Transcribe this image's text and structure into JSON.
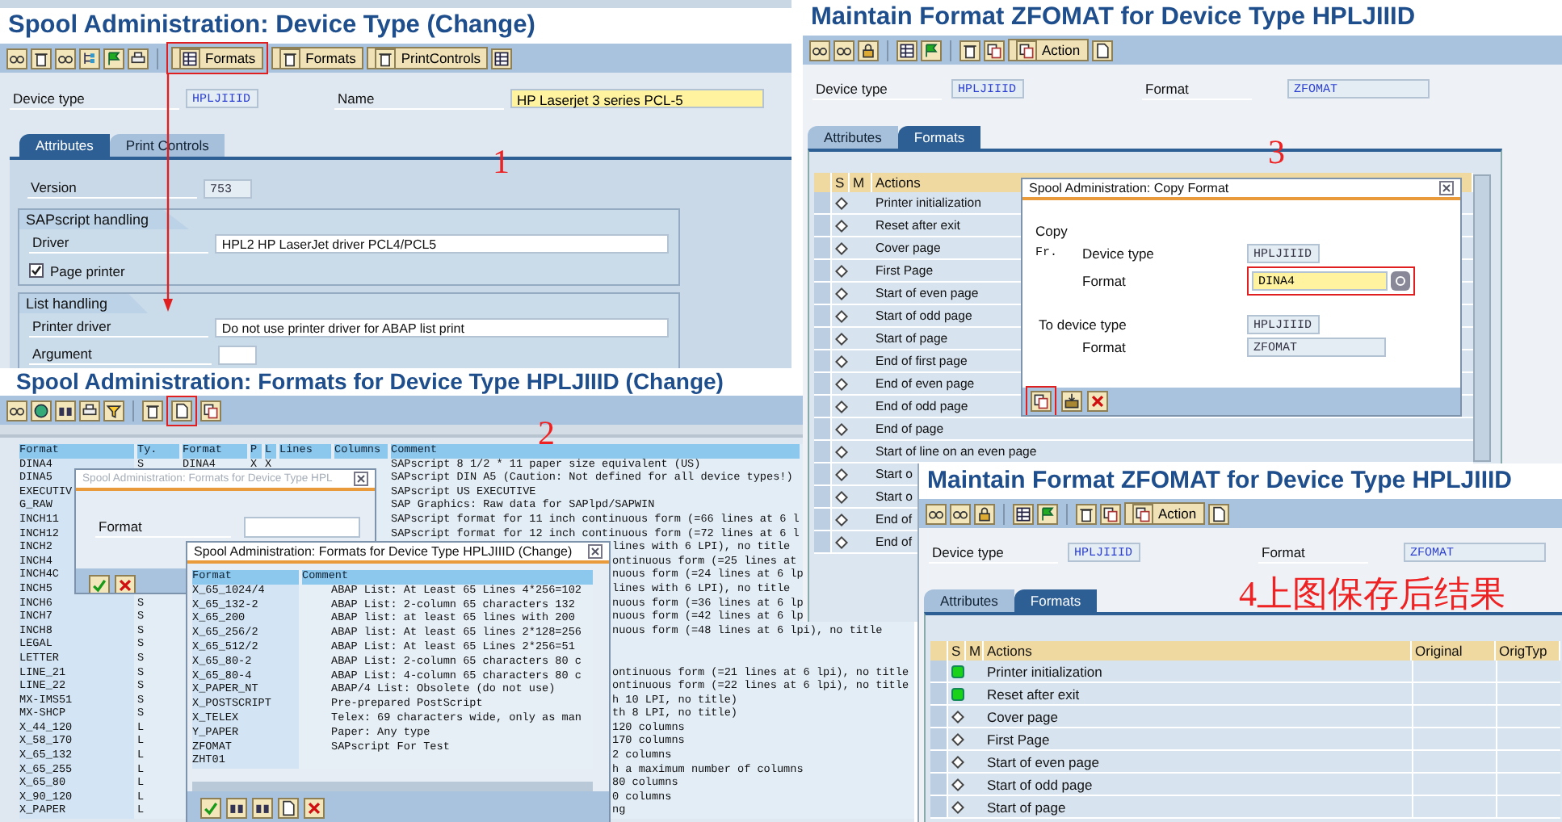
{
  "device_type_screen": {
    "title": "Spool Administration: Device Type (Change)",
    "toolbar": [
      {
        "label": "Formats",
        "highlighted": true
      },
      {
        "label": "Formats",
        "highlighted": false
      },
      {
        "label": "PrintControls",
        "highlighted": false
      }
    ],
    "fields": [
      {
        "label": "Device type",
        "value": "HPLJIIID",
        "kind": "display"
      },
      {
        "label": "Name",
        "value": "HP Laserjet 3 series PCL-5",
        "kind": "input"
      }
    ],
    "tabs": [
      {
        "label": "Attributes",
        "selected": true
      },
      {
        "label": "Print Controls",
        "selected": false
      }
    ],
    "annotation": "1",
    "version": {
      "label": "Version",
      "value": "753"
    },
    "groups": [
      {
        "title": "SAPscript handling",
        "rows": [
          {
            "kind": "field",
            "label": "Driver",
            "value": "HPL2 HP LaserJet driver PCL4/PCL5"
          },
          {
            "kind": "checkbox",
            "label": "Page printer",
            "checked": true
          }
        ]
      },
      {
        "title": "List handling",
        "rows": [
          {
            "kind": "field",
            "label": "Printer driver",
            "value": "Do not use printer driver for ABAP list print"
          },
          {
            "kind": "short",
            "label": "Argument"
          }
        ]
      }
    ]
  },
  "formats_screen": {
    "title": "Spool Administration: Formats for Device Type HPLJIIID (Change)",
    "toolbar": [
      {
        "highlighted": false
      },
      {
        "highlighted": false
      },
      {
        "highlighted": false
      },
      {
        "highlighted": false
      },
      {
        "highlighted": false
      },
      {
        "highlighted": false
      },
      {
        "highlighted": true
      },
      {
        "highlighted": false
      }
    ],
    "annotation": "2",
    "columns": [
      "Format",
      "Ty.",
      "Format",
      "P",
      "L",
      "Lines",
      "Columns",
      "Comment"
    ],
    "rows": [
      {
        "format": "DINA4",
        "type": "S",
        "format_2": "DINA4",
        "p": "X",
        "l": "X",
        "comment": "SAPscript 8 1/2 * 11 paper size equivalent (US)"
      },
      {
        "format": "DINA5",
        "comment": "SAPscript DIN A5 (Caution: Not defined for all device types!)"
      },
      {
        "format": "EXECUTIV",
        "comment": "SAPscript US EXECUTIVE"
      },
      {
        "format": "G_RAW",
        "comment": "SAP Graphics: Raw data for SAPlpd/SAPWIN"
      },
      {
        "format": "INCH11",
        "comment": "SAPscript format for 11 inch continuous form (=66 lines at 6 l"
      },
      {
        "format": "INCH12",
        "comment": "SAPscript format for 12 inch continuous form (=72 lines at 6 l"
      },
      {
        "format": "INCH2",
        "comment_tail": "lines with 6 LPI), no title"
      },
      {
        "format": "INCH4",
        "comment_tail": "ontinuous form (=25 lines at"
      },
      {
        "format": "INCH4C",
        "comment_tail": "nuous form (=24 lines at 6 lp"
      },
      {
        "format": "INCH5",
        "comment_tail": "lines with 6 LPI), no title"
      },
      {
        "format": "INCH6",
        "type": "S",
        "comment_tail": "nuous form (=36 lines at 6 lp"
      },
      {
        "format": "INCH7",
        "type": "S",
        "comment_tail": "nuous form (=42 lines at 6 lp"
      },
      {
        "format": "INCH8",
        "type": "S",
        "comment_tail": "nuous form (=48 lines at 6 lpi), no title"
      },
      {
        "format": "LEGAL",
        "type": "S"
      },
      {
        "format": "LETTER",
        "type": "S"
      },
      {
        "format": "LINE_21",
        "type": "S",
        "comment_tail": "ontinuous form (=21 lines at 6 lpi), no title"
      },
      {
        "format": "LINE_22",
        "type": "S",
        "comment_tail": "ontinuous form (=22 lines at 6 lpi), no title"
      },
      {
        "format": "MX-IMS51",
        "type": "S",
        "comment_tail": "h 10 LPI, no title)"
      },
      {
        "format": "MX-SHCP",
        "type": "S",
        "comment_tail": "th 8 LPI, no title)"
      },
      {
        "format": "X_44_120",
        "type": "L",
        "comment_tail": "120 columns"
      },
      {
        "format": "X_58_170",
        "type": "L",
        "comment_tail": "170 columns"
      },
      {
        "format": "X_65_132",
        "type": "L",
        "comment_tail": "2 columns"
      },
      {
        "format": "X_65_255",
        "type": "L",
        "comment_tail": "h a maximum number of columns"
      },
      {
        "format": "X_65_80",
        "type": "L",
        "comment_tail": "80 columns"
      },
      {
        "format": "X_90_120",
        "type": "L",
        "comment_tail": "0 columns"
      },
      {
        "format": "X_PAPER",
        "type": "L",
        "comment_tail": "ng"
      }
    ],
    "format_dialog": {
      "title": "Spool Administration: Formats for Device Type HPL",
      "field_label": "Format"
    },
    "list_dialog": {
      "title": "Spool Administration: Formats for Device Type HPLJIIID (Change)",
      "columns": [
        "Format",
        "Comment"
      ],
      "rows": [
        {
          "format": "X_65_1024/4",
          "comment": "ABAP List: At Least 65 Lines 4*256=102"
        },
        {
          "format": "X_65_132-2",
          "comment": "ABAP List: 2-column 65 characters 132"
        },
        {
          "format": "X_65_200",
          "comment": "ABAP list: at least 65 lines with 200"
        },
        {
          "format": "X_65_256/2",
          "comment": "ABAP list: At least 65 lines 2*128=256"
        },
        {
          "format": "X_65_512/2",
          "comment": "ABAP List:  At least 65 Lines 2*256=51"
        },
        {
          "format": "X_65_80-2",
          "comment": "ABAP List: 2-column 65 characters 80 c"
        },
        {
          "format": "X_65_80-4",
          "comment": "ABAP List: 4-column 65 characters 80 c"
        },
        {
          "format": "X_PAPER_NT",
          "comment": "ABAP/4 List: Obsolete (do not use)"
        },
        {
          "format": "X_POSTSCRIPT",
          "comment": "Pre-prepared PostScript"
        },
        {
          "format": "X_TELEX",
          "comment": "Telex: 69 characters wide, only as man"
        },
        {
          "format": "Y_PAPER",
          "comment": "Paper: Any type"
        },
        {
          "format": "ZFOMAT",
          "comment": "SAPscript For Test"
        },
        {
          "format": "ZHT01"
        }
      ]
    }
  },
  "copy_screen": {
    "title": "Maintain Format ZFOMAT for Device Type HPLJIIID",
    "action_button": "Action",
    "fields": [
      {
        "label": "Device type",
        "value": "HPLJIIID"
      },
      {
        "label": "Format",
        "value": "ZFOMAT"
      }
    ],
    "tabs": [
      {
        "label": "Attributes",
        "selected": false
      },
      {
        "label": "Formats",
        "selected": true
      }
    ],
    "annotation": "3",
    "columns": [
      "S",
      "M",
      "Actions"
    ],
    "rows": [
      {
        "kind": "empty",
        "label": "Printer initialization"
      },
      {
        "kind": "empty",
        "label": "Reset after exit"
      },
      {
        "kind": "empty",
        "label": "Cover page"
      },
      {
        "kind": "empty",
        "label": "First Page"
      },
      {
        "kind": "empty",
        "label": "Start of even page"
      },
      {
        "kind": "empty",
        "label": "Start of odd page"
      },
      {
        "kind": "empty",
        "label": "Start of page"
      },
      {
        "kind": "empty",
        "label": "End of first page"
      },
      {
        "kind": "empty",
        "label": "End of even page"
      },
      {
        "kind": "empty",
        "label": "End of odd page"
      },
      {
        "kind": "empty",
        "label": "End of page"
      },
      {
        "kind": "empty",
        "label": "Start of line on an even page"
      },
      {
        "kind": "empty",
        "label": "Start o"
      },
      {
        "kind": "empty",
        "label": "Start o"
      },
      {
        "kind": "empty",
        "label": "End of"
      },
      {
        "kind": "empty",
        "label": "End of"
      }
    ],
    "dialog": {
      "title": "Spool Administration: Copy Format",
      "section": "Copy",
      "rows": [
        {
          "kind": "display",
          "prefix": "Fr.",
          "label": "Device type",
          "value": "HPLJIIID"
        },
        {
          "kind": "input",
          "label": "Format",
          "value": "DINA4",
          "highlighted": true
        },
        {
          "kind": "target",
          "label": "To device type",
          "value": "HPLJIIID"
        },
        {
          "kind": "wide",
          "label": "Format",
          "value": "ZFOMAT"
        }
      ],
      "buttons": [
        {
          "highlighted": true
        },
        {
          "highlighted": false
        },
        {
          "highlighted": false
        }
      ]
    }
  },
  "result_screen": {
    "title": "Maintain Format ZFOMAT for Device Type HPLJIIID",
    "action_button": "Action",
    "fields": [
      {
        "label": "Device type",
        "value": "HPLJIIID"
      },
      {
        "label": "Format",
        "value": "ZFOMAT"
      }
    ],
    "tabs": [
      {
        "label": "Attributes",
        "selected": false
      },
      {
        "label": "Formats",
        "selected": true
      }
    ],
    "annotation": "4上图保存后结果",
    "columns": [
      "S",
      "M",
      "Actions",
      "Original",
      "OrigTyp"
    ],
    "rows": [
      {
        "kind": "filled",
        "label": "Printer initialization"
      },
      {
        "kind": "filled",
        "label": "Reset after exit"
      },
      {
        "kind": "empty",
        "label": "Cover page"
      },
      {
        "kind": "empty",
        "label": "First Page"
      },
      {
        "kind": "empty",
        "label": "Start of even page"
      },
      {
        "kind": "empty",
        "label": "Start of odd page"
      },
      {
        "kind": "empty",
        "label": "Start of page"
      }
    ]
  }
}
